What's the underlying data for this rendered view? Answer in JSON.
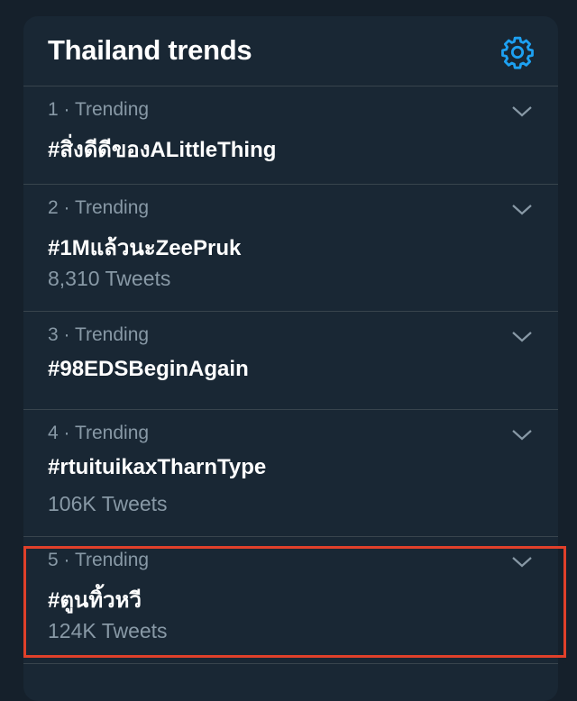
{
  "header": {
    "title": "Thailand trends",
    "settings_icon": "gear-icon"
  },
  "trends": [
    {
      "meta": "1 · Trending",
      "name": "#สิ่งดีดีของALittleThing",
      "count": ""
    },
    {
      "meta": "2 · Trending",
      "name": "#1Mแล้วนะZeePruk",
      "count": "8,310 Tweets"
    },
    {
      "meta": "3 · Trending",
      "name": "#98EDSBeginAgain",
      "count": ""
    },
    {
      "meta": "4 · Trending",
      "name": "#rtuituikaxTharnType",
      "count": "106K Tweets"
    },
    {
      "meta": "5 · Trending",
      "name": "#ตูนทิ้วหวี",
      "count": "124K Tweets"
    }
  ],
  "colors": {
    "background": "#15202b",
    "panel": "#192734",
    "accent": "#1da1f2",
    "highlight_box": "#e0402a"
  }
}
